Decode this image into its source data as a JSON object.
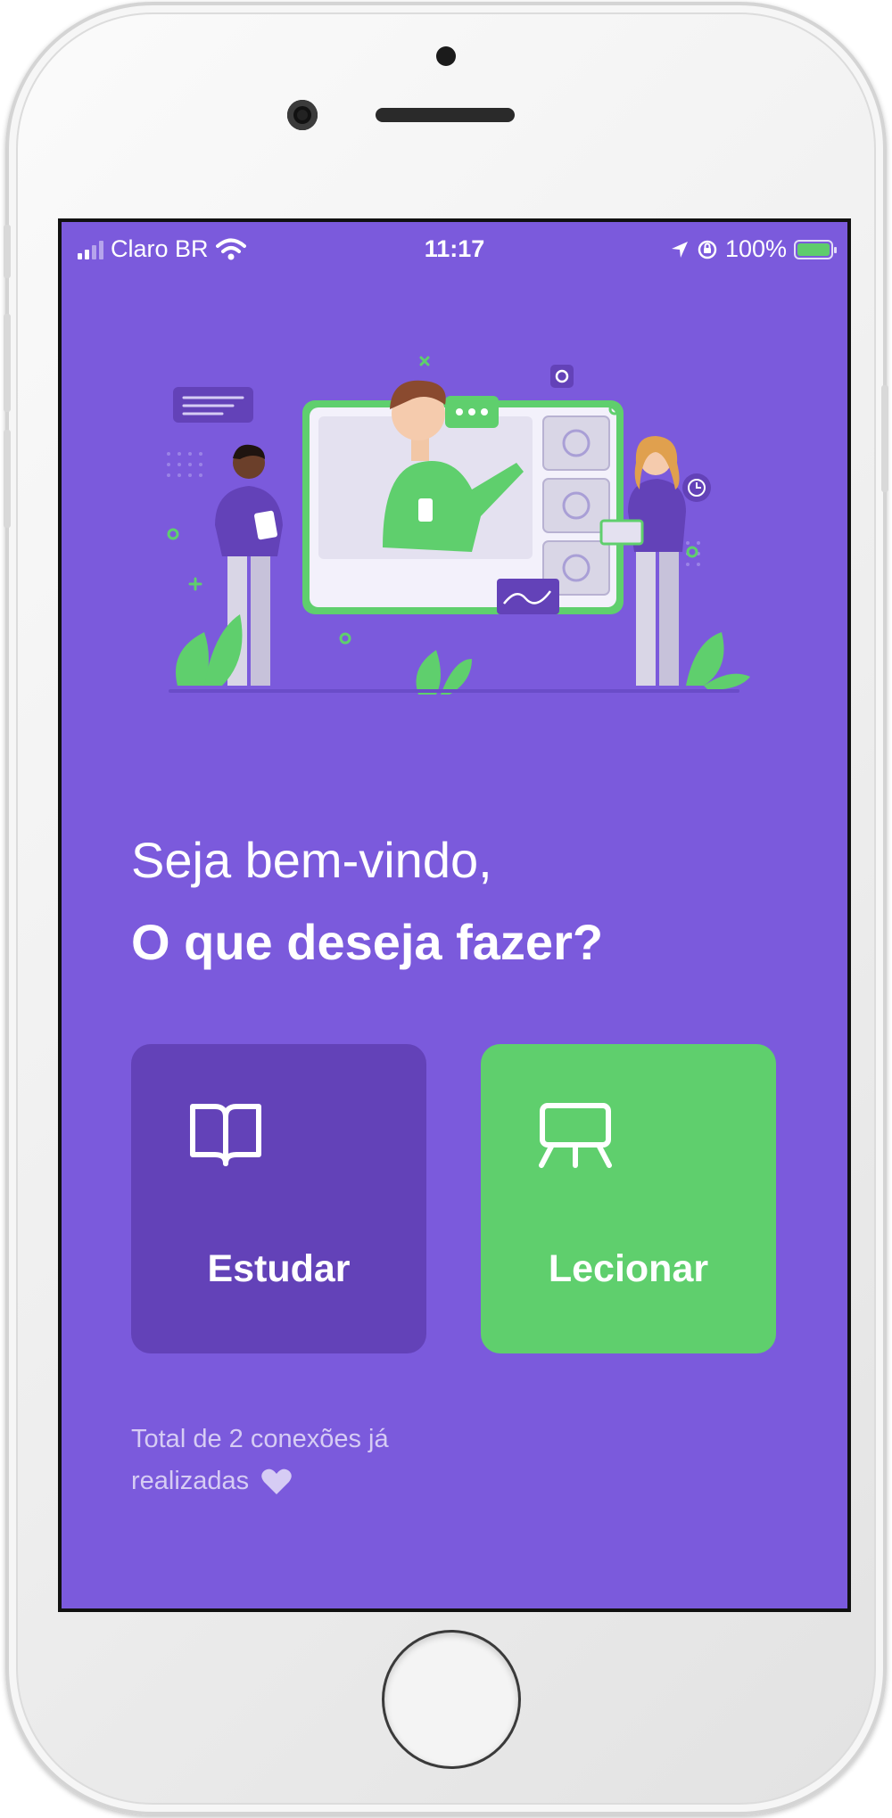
{
  "status_bar": {
    "carrier": "Claro BR",
    "time": "11:17",
    "battery_percent": "100%",
    "battery_level": 1.0,
    "signal_bars": 2
  },
  "greeting": {
    "line1": "Seja bem-vindo,",
    "line2": "O que deseja fazer?"
  },
  "actions": [
    {
      "label": "Estudar",
      "icon": "book-open-icon",
      "color": "#6342b8"
    },
    {
      "label": "Lecionar",
      "icon": "presentation-easel-icon",
      "color": "#5fcf6d"
    }
  ],
  "footer": {
    "line1": "Total de 2 conexões já",
    "line2": "realizadas",
    "icon": "heart-icon"
  },
  "colors": {
    "background": "#7b5adc",
    "primary_dark": "#6342b8",
    "secondary": "#5fcf6d",
    "text_muted": "#d6ccf4"
  }
}
